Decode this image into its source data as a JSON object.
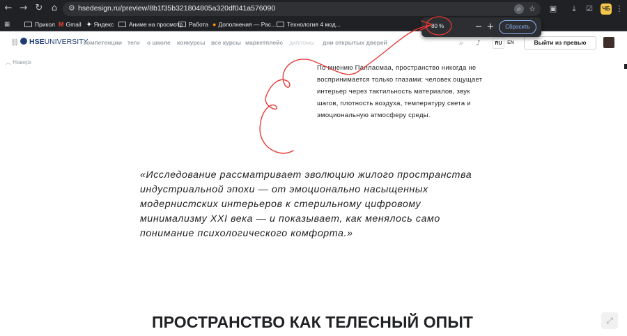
{
  "browser": {
    "url": "hsedesign.ru/preview/8b1f35b321804805a320df041a576090",
    "icons": {
      "back": "back-arrow-icon",
      "forward": "forward-arrow-icon",
      "reload": "reload-icon",
      "home": "home-icon",
      "site_info": "tune-icon",
      "zoom": "magnifier-icon",
      "bookmark": "star-icon",
      "extensions": "puzzle-icon",
      "download": "download-icon",
      "extension_check": "checklist-icon",
      "menu": "kebab-menu-icon",
      "apps": "apps-grid-icon"
    },
    "extension_badge": "ЧБ",
    "bookmarks": [
      {
        "label": "Прикол",
        "icon": "folder"
      },
      {
        "label": "Gmail",
        "icon": "gmail"
      },
      {
        "label": "Яндекс",
        "icon": "yandex"
      },
      {
        "label": "Аниме на просмотр",
        "icon": "folder"
      },
      {
        "label": "Работа",
        "icon": "folder"
      },
      {
        "label": "Дополнения — Рас...",
        "icon": "firefox"
      },
      {
        "label": "Технология 4 мод...",
        "icon": "folder"
      }
    ]
  },
  "zoom_popup": {
    "level": "80 %",
    "minus": "−",
    "plus": "+",
    "reset_label": "Сбросить"
  },
  "site_header": {
    "logo_bold": "HSE",
    "logo_text": "UNIVERSITY",
    "nav": [
      "компетенции",
      "теги",
      "о школе",
      "конкурсы",
      "все курсы",
      "маркетплейс",
      "дипломы",
      "дни открытых дверей"
    ],
    "lang_active": "RU",
    "lang_inactive": "EN",
    "exit_label": "Выйти из превью"
  },
  "back_top_label": "Наверх",
  "body_paragraph": "По мнению Палласмаа, пространство никогда не воспринимается только глазами: человек ощущает интерьер через тактильность материалов, звук шагов, плотность воздуха, температуру света и эмоциональную атмосферу среды.",
  "quote": "«Исследование рассматривает эволюцию жилого пространства индустриальной эпохи — от эмоционально насыщенных модернистских интерьеров к стерильному цифровому минимализму XXI века — и показывает, как менялось само понимание психологического комфорта.»",
  "section_title": "ПРОСТРАНСТВО КАК ТЕЛЕСНЫЙ ОПЫТ",
  "colors": {
    "chrome_bg": "#202124",
    "omnibox_bg": "#303134",
    "accent_blue": "#8ab4f8",
    "annotation_red": "#e53935",
    "brand_navy": "#1f3b73"
  }
}
